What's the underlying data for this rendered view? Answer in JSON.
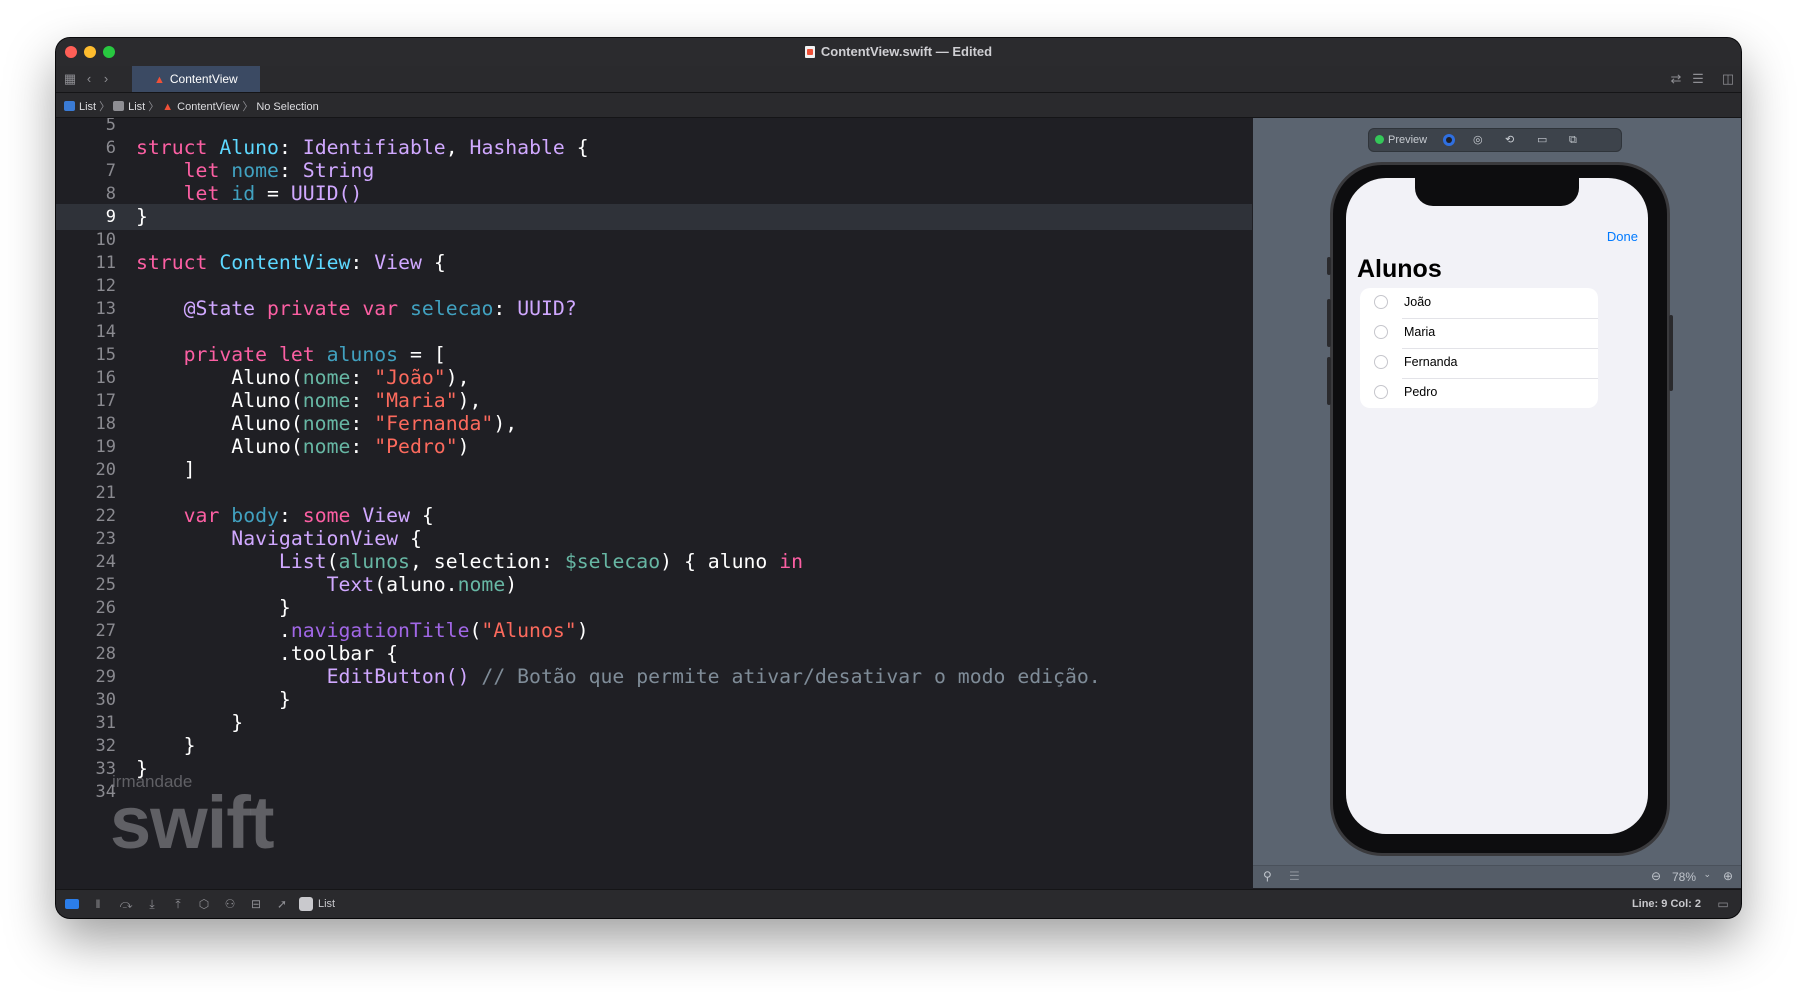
{
  "window": {
    "title": "ContentView.swift — Edited"
  },
  "tabbar": {
    "active_tab": "ContentView"
  },
  "jumpbar": {
    "crumbs": [
      "List",
      "List",
      "ContentView",
      "No Selection"
    ]
  },
  "editor": {
    "current_line": 9,
    "lines": [
      {
        "n": "5"
      },
      {
        "n": "6"
      },
      {
        "n": "7"
      },
      {
        "n": "8"
      },
      {
        "n": "9"
      },
      {
        "n": "10"
      },
      {
        "n": "11"
      },
      {
        "n": "12"
      },
      {
        "n": "13"
      },
      {
        "n": "14"
      },
      {
        "n": "15"
      },
      {
        "n": "16"
      },
      {
        "n": "17"
      },
      {
        "n": "18"
      },
      {
        "n": "19"
      },
      {
        "n": "20"
      },
      {
        "n": "21"
      },
      {
        "n": "22"
      },
      {
        "n": "23"
      },
      {
        "n": "24"
      },
      {
        "n": "25"
      },
      {
        "n": "26"
      },
      {
        "n": "27"
      },
      {
        "n": "28"
      },
      {
        "n": "29"
      },
      {
        "n": "30"
      },
      {
        "n": "31"
      },
      {
        "n": "32"
      },
      {
        "n": "33"
      },
      {
        "n": "34"
      }
    ],
    "tokens": {
      "struct": "struct",
      "aluno_type": "Aluno",
      "colon": ":",
      "identifiable": "Identifiable",
      "comma": ",",
      "hashable": "Hashable",
      "open_brace": "{",
      "close_brace": "}",
      "let": "let",
      "nome": "nome",
      "string": "String",
      "id": "id",
      "eq": "=",
      "uuid_call": "UUID()",
      "contentview": "ContentView",
      "view": "View",
      "state": "@State",
      "private": "private",
      "var": "var",
      "selecao": "selecao",
      "uuid_opt": "UUID?",
      "alunos": "alunos",
      "open_bracket": "[",
      "close_bracket": "]",
      "aluno_call": "Aluno(",
      "name1": "\"João\"",
      "name2": "\"Maria\"",
      "name3": "\"Fernanda\"",
      "name4": "\"Pedro\"",
      "close_paren_comma": "),",
      "close_paren": ")",
      "body": "body",
      "some": "some",
      "navview": "NavigationView",
      "list": "List",
      "open_paren": "(",
      "selection_label": "selection",
      "binding": "$selecao",
      "aluno": "aluno",
      "in": "in",
      "text": "Text",
      "aluno_dot": "aluno.",
      "dot": ".",
      "navtitle": "navigationTitle",
      "alunos_str": "\"Alunos\"",
      "toolbar": "toolbar",
      "editbutton": "EditButton()",
      "comment": "// Botão que permite ativar/desativar o modo edição."
    }
  },
  "watermark": {
    "small": "irmandade",
    "big": "swift"
  },
  "preview": {
    "toolbar_label": "Preview",
    "done_label": "Done",
    "nav_title": "Alunos",
    "items": [
      {
        "label": "João"
      },
      {
        "label": "Maria"
      },
      {
        "label": "Fernanda"
      },
      {
        "label": "Pedro"
      }
    ],
    "zoom": "78%"
  },
  "statusbar": {
    "scheme": "List",
    "cursor": "Line: 9  Col: 2"
  },
  "colors": {
    "keyword": "#fc5fa3",
    "type": "#d0a8ff",
    "declared_type": "#5dd8ff",
    "string": "#fc6a5d",
    "comment": "#7f8c98",
    "accent": "#007aff"
  }
}
